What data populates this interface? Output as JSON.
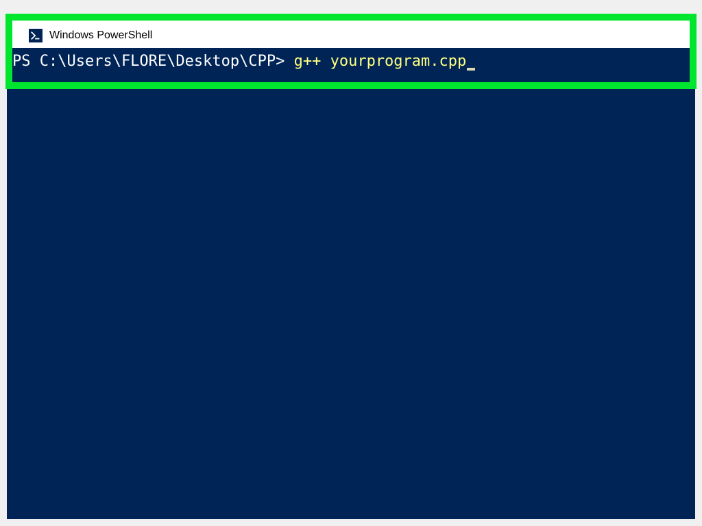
{
  "window": {
    "title": "Windows PowerShell"
  },
  "terminal": {
    "prompt": "PS C:\\Users\\FLORE\\Desktop\\CPP> ",
    "command": "g++ yourprogram.cpp"
  },
  "colors": {
    "terminal_bg": "#012456",
    "highlight_border": "#00e62e",
    "prompt_color": "#ffffff",
    "command_color": "#ffff80"
  }
}
